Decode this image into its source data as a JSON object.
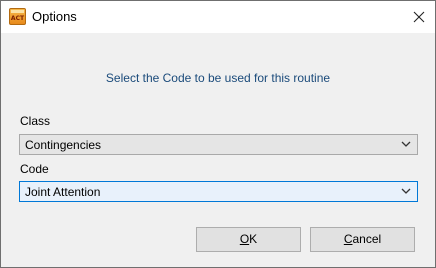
{
  "window": {
    "title": "Options",
    "app_icon_text": "ACT"
  },
  "prompt": "Select the Code to be used for this routine",
  "class_field": {
    "label": "Class",
    "value": "Contingencies"
  },
  "code_field": {
    "label": "Code",
    "value": "Joint Attention"
  },
  "buttons": {
    "ok": {
      "mnemonic": "O",
      "rest": "K"
    },
    "cancel": {
      "mnemonic": "C",
      "rest": "ancel"
    }
  },
  "colors": {
    "prompt_text": "#1a4a7a",
    "focus_border": "#0078d7",
    "focus_fill": "#e8f1fb"
  }
}
